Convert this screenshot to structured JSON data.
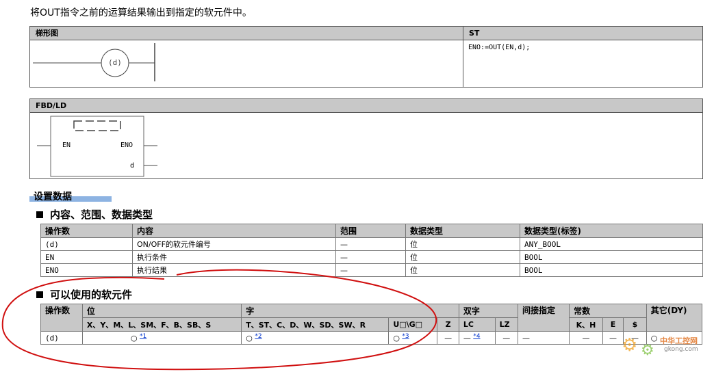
{
  "intro": "将OUT指令之前的运算结果输出到指定的软元件中。",
  "ladder": {
    "header": "梯形图",
    "coil_label": "(d)"
  },
  "st": {
    "header": "ST",
    "code": "ENO:=OUT(EN,d);"
  },
  "fbd": {
    "header": "FBD/LD",
    "pin_en": "EN",
    "pin_eno": "ENO",
    "pin_d": "d"
  },
  "settings": {
    "title": "设置数据"
  },
  "section1": {
    "title": "内容、范围、数据类型",
    "headers": [
      "操作数",
      "内容",
      "范围",
      "数据类型",
      "数据类型(标签)"
    ],
    "rows": [
      [
        "(d)",
        "ON/OFF的软元件编号",
        "—",
        "位",
        "ANY_BOOL"
      ],
      [
        "EN",
        "执行条件",
        "—",
        "位",
        "BOOL"
      ],
      [
        "ENO",
        "执行结果",
        "—",
        "位",
        "BOOL"
      ]
    ]
  },
  "section2": {
    "title": "可以使用的软元件",
    "h_operand": "操作数",
    "h_bit": "位",
    "h_word": "字",
    "h_dword": "双字",
    "h_indirect": "间接指定",
    "h_const": "常数",
    "h_other": "其它(DY)",
    "sub": [
      "X、Y、M、L、SM、F、B、SB、S",
      "T、ST、C、D、W、SD、SW、R",
      "U□\\G□",
      "Z",
      "LC",
      "LZ",
      "K、H",
      "E",
      "$"
    ],
    "row_label": "(d)",
    "cells": [
      "○",
      "○",
      "○",
      "—",
      "—",
      "—",
      "—",
      "—",
      "—",
      "—",
      "○"
    ],
    "notes": [
      "*1",
      "*2",
      "*3",
      "*4"
    ]
  },
  "watermark": {
    "brand": "中华工控网",
    "url": "gkong.com"
  },
  "colors": {
    "header_bg": "#c8c8c8",
    "underline_blue": "#8db3e2",
    "annotation_red": "#d01010",
    "watermark_orange": "#f0a020"
  }
}
